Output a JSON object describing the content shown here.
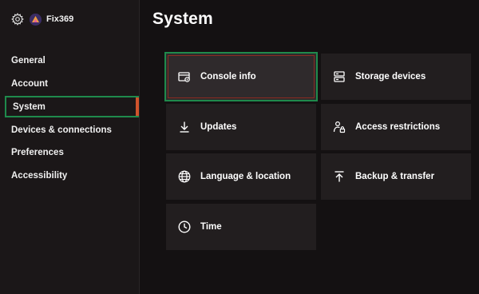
{
  "profile": {
    "gamertag": "Fix369"
  },
  "sidebar": {
    "items": [
      {
        "label": "General"
      },
      {
        "label": "Account"
      },
      {
        "label": "System"
      },
      {
        "label": "Devices & connections"
      },
      {
        "label": "Preferences"
      },
      {
        "label": "Accessibility"
      }
    ],
    "selected": "System"
  },
  "main": {
    "title": "System",
    "tiles": [
      {
        "label": "Console info",
        "icon": "console-info-icon"
      },
      {
        "label": "Storage devices",
        "icon": "storage-icon"
      },
      {
        "label": "Updates",
        "icon": "download-icon"
      },
      {
        "label": "Access restrictions",
        "icon": "access-restrictions-icon"
      },
      {
        "label": "Language & location",
        "icon": "globe-icon"
      },
      {
        "label": "Backup & transfer",
        "icon": "upload-icon"
      },
      {
        "label": "Time",
        "icon": "clock-icon"
      }
    ]
  },
  "colors": {
    "focus_outline": "#1f8a4c",
    "selection_accent": "#d0532c",
    "background": "#141112",
    "tile": "#221e1f"
  }
}
